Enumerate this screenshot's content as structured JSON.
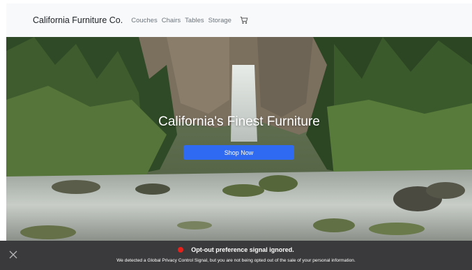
{
  "navbar": {
    "brand": "California Furniture Co.",
    "links": [
      "Couches",
      "Chairs",
      "Tables",
      "Storage"
    ],
    "cart_icon": "cart-icon"
  },
  "hero": {
    "title": "California's Finest Furniture",
    "button_label": "Shop Now",
    "button_color": "#2f6bf2"
  },
  "banner": {
    "close_icon": "close-icon",
    "status_color": "#e8201a",
    "title": "Opt-out preference signal ignored.",
    "message": "We detected a Global Privacy Control Signal, but you are not being opted out of the sale of your personal information."
  }
}
